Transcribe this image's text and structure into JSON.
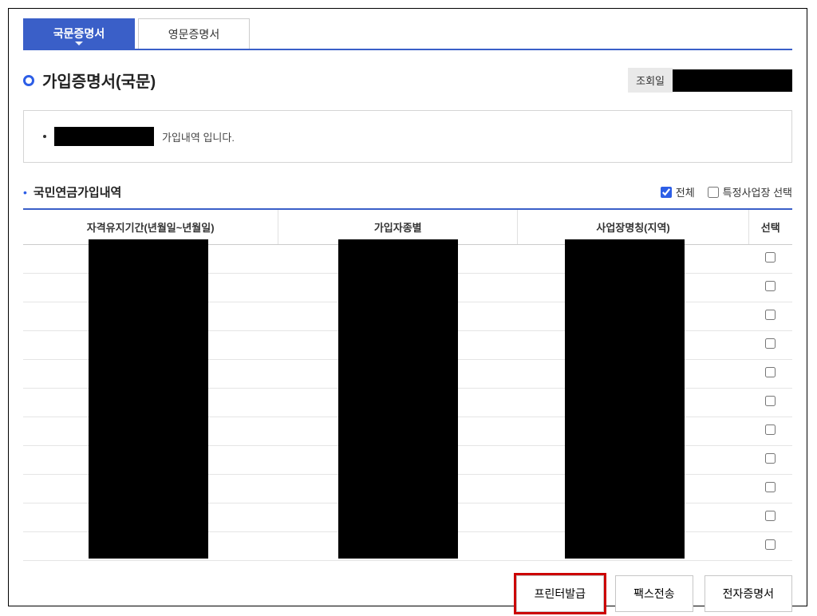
{
  "tabs": {
    "active": "국문증명서",
    "inactive": "영문증명서"
  },
  "title": "가입증명서(국문)",
  "lookup_label": "조회일",
  "info_suffix": "가입내역 입니다.",
  "section_title": "국민연금가입내역",
  "filters": {
    "all": "전체",
    "specific": "특정사업장 선택"
  },
  "table": {
    "headers": {
      "period": "자격유지기간(년월일~년월일)",
      "type": "가입자종별",
      "place": "사업장명칭(지역)",
      "select": "선택"
    },
    "row_count": 11
  },
  "actions": {
    "print": "프린터발급",
    "fax": "팩스전송",
    "ecert": "전자증명서"
  }
}
